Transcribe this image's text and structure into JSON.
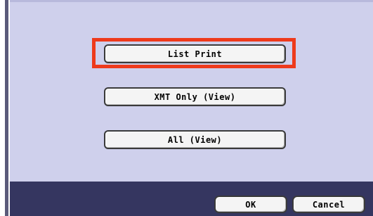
{
  "menu": {
    "list_print_label": "List Print",
    "xmt_only_label": "XMT Only (View)",
    "all_label": "All (View)"
  },
  "footer": {
    "ok_label": "OK",
    "cancel_label": "Cancel"
  },
  "colors": {
    "panel_bg": "#cfd0ec",
    "footer_bg": "#353660",
    "highlight": "#ee3a1c"
  }
}
